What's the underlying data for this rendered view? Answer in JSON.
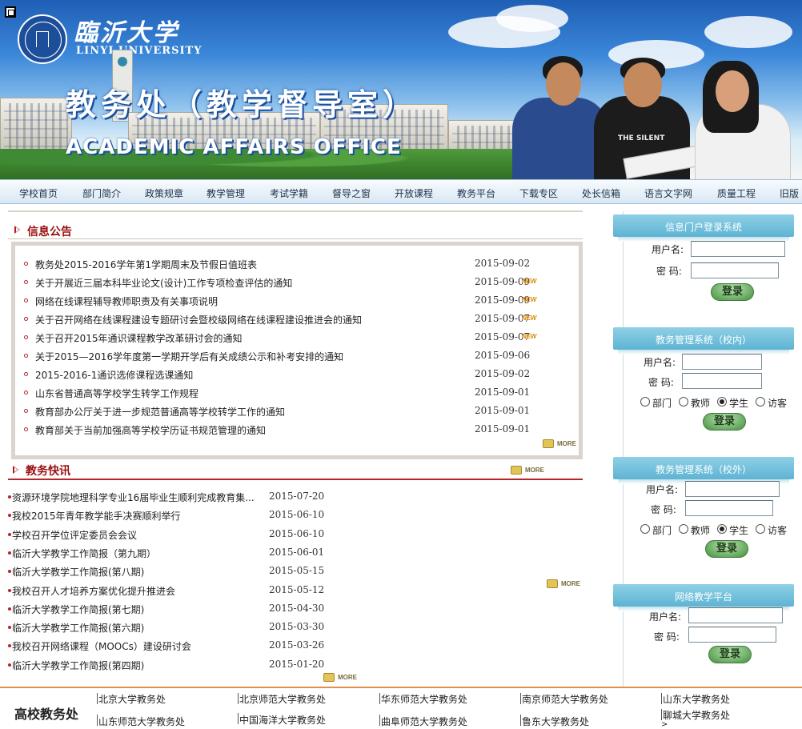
{
  "header": {
    "univ_cn": "臨沂大学",
    "univ_en": "LINYI UNIVERSITY",
    "dept_cn": "教务处（教学督导室）",
    "dept_en": "ACADEMIC AFFAIRS OFFICE",
    "seal_year": "1941",
    "shirt_text": "THE SILENT"
  },
  "nav": {
    "items": [
      "学校首页",
      "部门简介",
      "政策规章",
      "教学管理",
      "考试学籍",
      "督导之窗",
      "开放课程",
      "教务平台",
      "下载专区",
      "处长信箱",
      "语言文字网",
      "质量工程",
      "旧版"
    ]
  },
  "notices": {
    "heading": "信息公告",
    "more": "MORE",
    "new_tag": "NEW",
    "items": [
      {
        "title": "教务处2015-2016学年第1学期周末及节假日值班表",
        "date": "2015-09-02",
        "new": false
      },
      {
        "title": "关于开展近三届本科毕业论文(设计)工作专项检查评估的通知",
        "date": "2015-09-09",
        "new": true
      },
      {
        "title": "网络在线课程辅导教师职责及有关事项说明",
        "date": "2015-09-09",
        "new": true
      },
      {
        "title": "关于召开网络在线课程建设专题研讨会暨校级网络在线课程建设推进会的通知",
        "date": "2015-09-07",
        "new": true
      },
      {
        "title": "关于召开2015年通识课程教学改革研讨会的通知",
        "date": "2015-09-07",
        "new": true
      },
      {
        "title": "关于2015—2016学年度第一学期开学后有关成绩公示和补考安排的通知",
        "date": "2015-09-06",
        "new": false
      },
      {
        "title": "2015-2016-1通识选修课程选课通知",
        "date": "2015-09-02",
        "new": false
      },
      {
        "title": "山东省普通高等学校学生转学工作规程",
        "date": "2015-09-01",
        "new": false
      },
      {
        "title": "教育部办公厅关于进一步规范普通高等学校转学工作的通知",
        "date": "2015-09-01",
        "new": false
      },
      {
        "title": "教育部关于当前加强高等学校学历证书规范管理的通知",
        "date": "2015-09-01",
        "new": false
      }
    ]
  },
  "news": {
    "heading": "教务快讯",
    "more": "MORE",
    "items": [
      {
        "title": "资源环境学院地理科学专业16届毕业生顺利完成教育集...",
        "date": "2015-07-20"
      },
      {
        "title": "我校2015年青年教学能手决赛顺利举行",
        "date": "2015-06-10"
      },
      {
        "title": "学校召开学位评定委员会会议",
        "date": "2015-06-10"
      },
      {
        "title": "临沂大学教学工作简报（第九期）",
        "date": "2015-06-01"
      },
      {
        "title": "临沂大学教学工作简报(第八期)",
        "date": "2015-05-15"
      },
      {
        "title": "我校召开人才培养方案优化提升推进会",
        "date": "2015-05-12"
      },
      {
        "title": "临沂大学教学工作简报(第七期)",
        "date": "2015-04-30"
      },
      {
        "title": "临沂大学教学工作简报(第六期)",
        "date": "2015-03-30"
      },
      {
        "title": "我校召开网络课程（MOOCs）建设研讨会",
        "date": "2015-03-26"
      },
      {
        "title": "临沂大学教学工作简报(第四期)",
        "date": "2015-01-20"
      }
    ]
  },
  "logins": [
    {
      "title": "信息门户登录系统",
      "username_label": "用户名:",
      "password_label": "密  码:",
      "button": "登录",
      "roles": [],
      "selected_role": ""
    },
    {
      "title": "教务管理系统（校内）",
      "username_label": "用户名:",
      "password_label": "密  码:",
      "button": "登录",
      "roles": [
        "部门",
        "教师",
        "学生",
        "访客"
      ],
      "selected_role": "学生"
    },
    {
      "title": "教务管理系统（校外）",
      "username_label": "用户名:",
      "password_label": "密  码:",
      "button": "登录",
      "roles": [
        "部门",
        "教师",
        "学生",
        "访客"
      ],
      "selected_role": "学生"
    },
    {
      "title": "网络教学平台",
      "username_label": "用户名:",
      "password_label": "密  码:",
      "button": "登录",
      "roles": [],
      "selected_role": ""
    }
  ],
  "footer": {
    "title": "高校教务处",
    "links": [
      "北京大学教务处",
      "北京师范大学教务处",
      "华东师范大学教务处",
      "南京师范大学教务处",
      "山东大学教务处",
      "山东师范大学教务处",
      "中国海洋大学教务处",
      "曲阜师范大学教务处",
      "鲁东大学教务处",
      "聊城大学教务处"
    ],
    "trailing": ">"
  },
  "colors": {
    "accent_red": "#9a1010",
    "nav_bg": "#d9e8f4",
    "login_head": "#5eb4d3",
    "footer_rule": "#e0904a"
  }
}
